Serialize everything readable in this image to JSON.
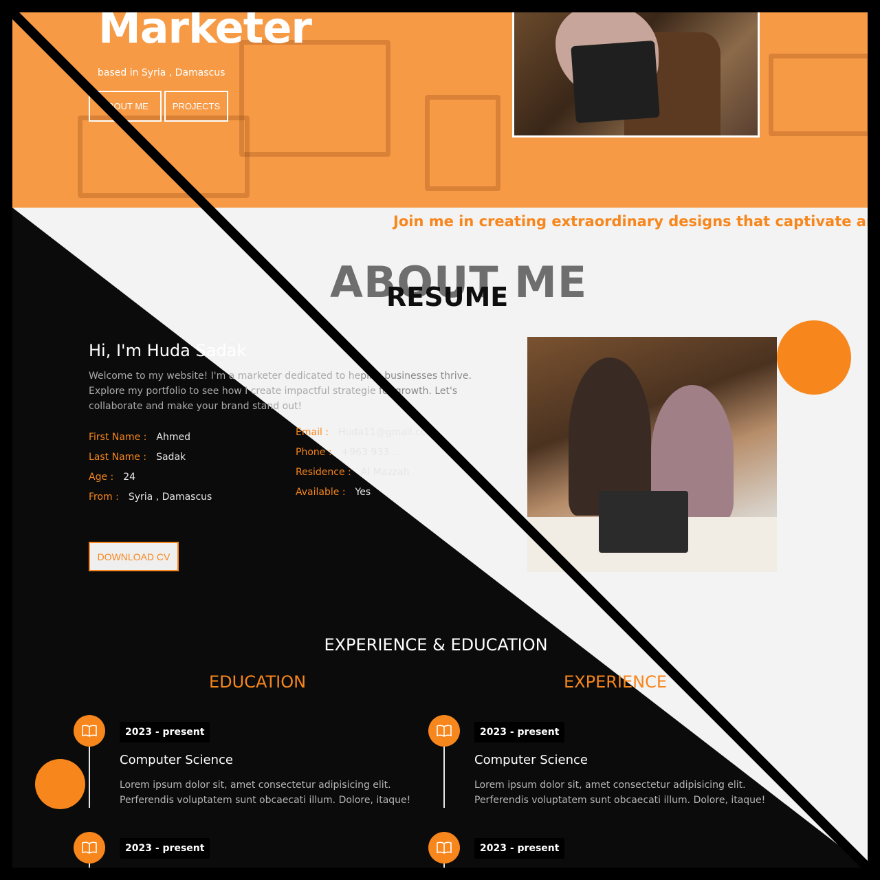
{
  "hero": {
    "title": "Marketer",
    "subtitle": "based in Syria , Damascus",
    "buttons": [
      "ABOUT ME",
      "PROJECTS"
    ]
  },
  "marquee": "Join me in creating extraordinary designs that captivate and i",
  "about": {
    "title": "ABOUT ME",
    "overlay_title": "RESUME",
    "greeting": "Hi, I'm Huda Sadak",
    "intro_dark": "Welcome to my website! I'm a marketer dedicated to he",
    "intro_light": "ping businesses thrive.",
    "intro_line2_dark": "Explore my portfolio to see how I create impactful strategie",
    "intro_line2_light": "for growth. Let's",
    "intro_line3": "collaborate and make your brand stand out!",
    "left_fields": [
      {
        "key": "First Name :",
        "value": "Ahmed"
      },
      {
        "key": "Last Name :",
        "value": "Sadak"
      },
      {
        "key": "Age :",
        "value": "24"
      },
      {
        "key": "From :",
        "value": "Syria , Damascus"
      }
    ],
    "right_fields": [
      {
        "key": "Email :",
        "value": "Huda11@gmail.com"
      },
      {
        "key": "Phone :",
        "value": "+963 933..."
      },
      {
        "key": "Residence :",
        "value": "Al Mazzah"
      },
      {
        "key": "Available :",
        "value": "Yes"
      }
    ],
    "download_label": "DOWNLOAD CV"
  },
  "resume": {
    "section_title": "EXPERIENCE & EDUCATION",
    "education_title": "EDUCATION",
    "experience_title": "EXPERIENCE",
    "entries": [
      {
        "date": "2023 - present",
        "title": "Computer Science",
        "desc_1": "Lorem ipsum dolor sit, amet consectetur adipisicing elit.",
        "desc_2": "Perferendis voluptatem sunt obcaecati illum. Dolore, itaque!"
      },
      {
        "date": "2023 - present",
        "title": "Computer Science",
        "desc_1": "Lorem ipsum dolor sit, amet consectetur adipisicing elit.",
        "desc_2": "Perferendis voluptatem sunt obcaecati illum. Dolore, itaque!"
      },
      {
        "date": "2023 - present"
      },
      {
        "date": "2023 - present"
      }
    ]
  },
  "colors": {
    "accent": "#f7861c",
    "hero_bg": "#f79a45",
    "dark_bg": "#0b0b0b",
    "light_bg": "#f3f3f3"
  },
  "icons": {
    "timeline": "book-icon"
  }
}
